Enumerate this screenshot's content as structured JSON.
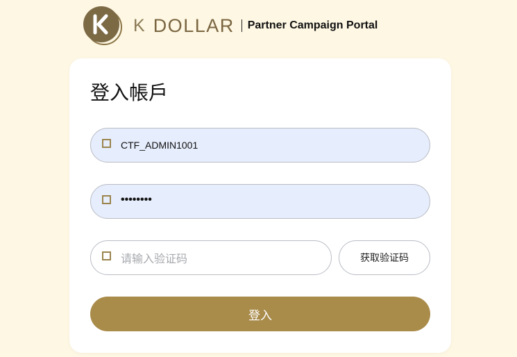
{
  "header": {
    "logo_letter": "K",
    "brand_prefix": "K",
    "brand_name": "DOLLAR",
    "portal_title": "Partner Campaign Portal"
  },
  "card": {
    "title": "登入帳戶",
    "username_value": "CTF_ADMIN1001",
    "password_value": "••••••••",
    "captcha_placeholder": "请输入验证码",
    "get_code_label": "获取验证码",
    "login_label": "登入"
  },
  "icons": {
    "logo": "k-coin-logo-icon",
    "field_prefix": "checkbox-square-icon"
  },
  "colors": {
    "background": "#fdf7e3",
    "brand": "#7a6540",
    "accent_button": "#a98b4a",
    "autofill_field": "#e6edfc"
  }
}
